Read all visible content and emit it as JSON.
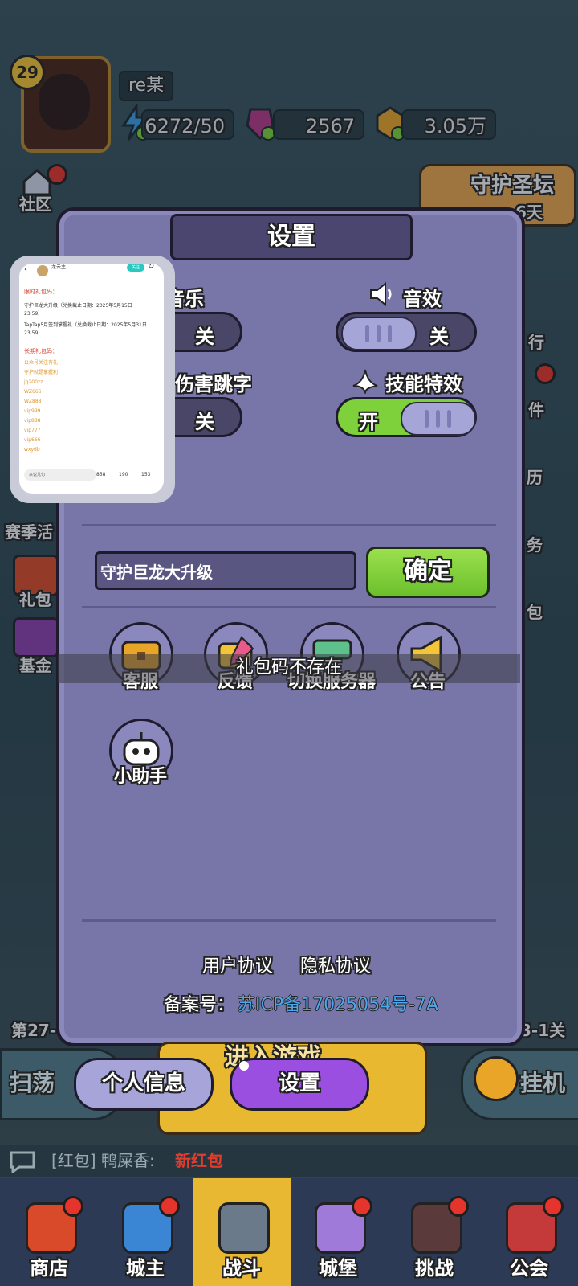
{
  "hud": {
    "level": "29",
    "player_name": "re某",
    "energy": "6272/50",
    "gems": "2567",
    "gold": "3.05万"
  },
  "side_left": {
    "community": "社区",
    "season": "赛季活",
    "gift": "礼包",
    "fund": "基金"
  },
  "side_right": {
    "guardian_altar": "守护圣坛",
    "days": "6天",
    "rank": "行",
    "mail": "件",
    "calendar": "历",
    "task": "务",
    "bag": "包"
  },
  "stage_left": "第27-",
  "stage_right": "3-1关",
  "modal": {
    "title": "设置",
    "music_label": "音乐",
    "music_state": "关",
    "sfx_label": "音效",
    "sfx_state": "关",
    "damage_label": "伤害跳字",
    "damage_state": "关",
    "skill_label": "技能特效",
    "skill_state": "开",
    "code_value": "守护巨龙大升级",
    "confirm": "确定",
    "buttons": [
      {
        "label": "客服",
        "icon": "chest-icon"
      },
      {
        "label": "反馈",
        "icon": "feedback-icon"
      },
      {
        "label": "切换服务器",
        "icon": "server-switch-icon"
      },
      {
        "label": "公告",
        "icon": "megaphone-icon"
      },
      {
        "label": "小助手",
        "icon": "robot-icon"
      }
    ],
    "toast": "礼包码不存在",
    "user_agreement": "用户协议",
    "privacy_policy": "隐私协议",
    "icp_label": "备案号：",
    "icp_value": "苏ICP备17025054号-7A"
  },
  "tabs": {
    "personal_info": "个人信息",
    "settings": "设置"
  },
  "sweep": "扫荡",
  "idle": "挂机",
  "battle_banner": "进入游戏",
  "chat": {
    "prefix": "[红包] 鸭屎香:",
    "highlight": "新红包"
  },
  "bottom_nav": [
    {
      "label": "商店"
    },
    {
      "label": "城主"
    },
    {
      "label": "战斗"
    },
    {
      "label": "城堡"
    },
    {
      "label": "挑战"
    },
    {
      "label": "公会"
    }
  ],
  "thumbnail": {
    "author": "龙云主",
    "follow": "关注",
    "limited_title": "限时礼包码：",
    "limited_1": "守护巨龙大升级（兑换截止日期：2025年5月15日 23:59）",
    "limited_2": "TapTap5月签到掌握礼（兑换截止日期：2025年5月31日 23:59）",
    "long_title": "长期礼包码：",
    "codes": [
      "公众号关注有礼",
      "守护就是掌握利",
      "jq200zz",
      "WZ666",
      "WZ888",
      "vip999",
      "vip888",
      "vip777",
      "vip666",
      "wxydb"
    ],
    "comment_placeholder": "来说几句",
    "likes": "858",
    "stars": "190",
    "comments": "153"
  },
  "colors": {
    "modal_bg": "#7875a8",
    "toggle_on": "#7fd13b",
    "settings_tab": "#9b4fe0",
    "icp_link": "#4aa8e8"
  }
}
